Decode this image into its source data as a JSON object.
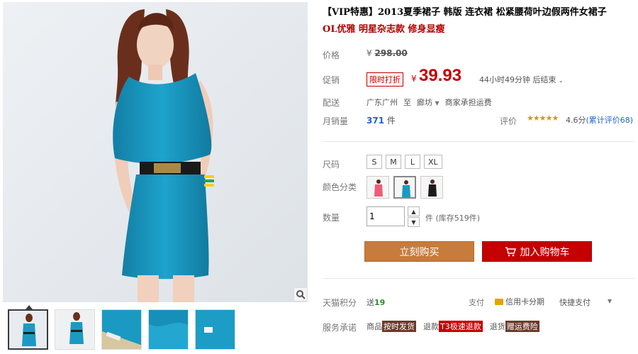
{
  "product": {
    "title": "【VIP特惠】2013夏季裙子 韩版 连衣裙 松紧腰荷叶边假两件女裙子",
    "subtitle": "OL优雅 明星杂志款 修身显瘦"
  },
  "price": {
    "label": "价格",
    "original": "298.00",
    "currency": "¥",
    "promo_label": "促销",
    "promo_badge": "限时打折",
    "current": "39.93",
    "countdown": "44小时49分钟 后结束"
  },
  "shipping": {
    "label": "配送",
    "from": "广东广州",
    "to_word": "至",
    "destination": "廊坊",
    "note": "商家承担运费"
  },
  "sales": {
    "label": "月销量",
    "count": "371",
    "unit": "件"
  },
  "rating": {
    "label": "评价",
    "stars": "★★★★★",
    "score": "4.6分",
    "reviews": "(累计评价68)",
    "score_value": 4.6
  },
  "options": {
    "size_label": "尺码",
    "sizes": [
      "S",
      "M",
      "L",
      "XL"
    ],
    "color_label": "颜色分类",
    "colors": [
      "pink",
      "blue",
      "black"
    ]
  },
  "quantity": {
    "label": "数量",
    "value": "1",
    "stock": "件 (库存519件)"
  },
  "buttons": {
    "buy": "立刻购买",
    "cart": "加入购物车"
  },
  "points": {
    "label": "天猫积分",
    "prefix": "送",
    "value": "19"
  },
  "payment": {
    "label": "支付",
    "credit": "信用卡分期",
    "quick": "快捷支付"
  },
  "service": {
    "label": "服务承诺",
    "items": [
      {
        "name": "商品",
        "tag": "按时发货"
      },
      {
        "name": "退款",
        "tag": "T3极速退款"
      },
      {
        "name": "退货",
        "tag": "赠运费险"
      }
    ]
  },
  "colors": {
    "accent": "#c40000",
    "buy_button": "#c77b3c",
    "dress": "#1a9ac2"
  }
}
